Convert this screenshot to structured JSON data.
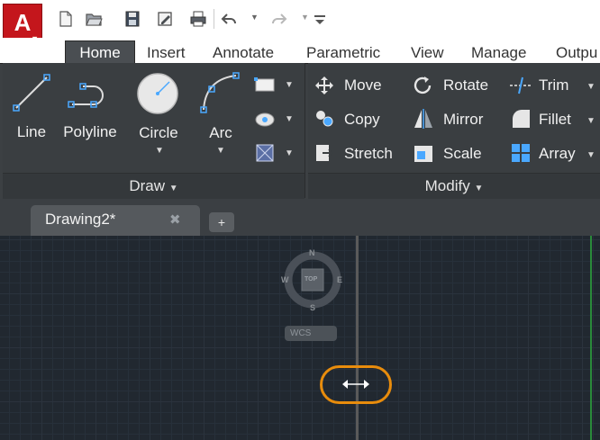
{
  "app": {
    "logo_letter": "A",
    "icons": [
      "new-file-icon",
      "open-folder-icon",
      "save-icon",
      "save-as-icon",
      "print-icon",
      "undo-icon",
      "redo-icon",
      "customize-icon"
    ]
  },
  "tabs": [
    {
      "label": "Home",
      "active": true
    },
    {
      "label": "Insert"
    },
    {
      "label": "Annotate"
    },
    {
      "label": "Parametric"
    },
    {
      "label": "View"
    },
    {
      "label": "Manage"
    },
    {
      "label": "Outpu"
    }
  ],
  "draw_panel": {
    "title": "Draw",
    "tools": [
      {
        "label": "Line"
      },
      {
        "label": "Polyline"
      },
      {
        "label": "Circle"
      },
      {
        "label": "Arc"
      }
    ]
  },
  "modify_panel": {
    "title": "Modify",
    "tools": [
      {
        "label": "Move"
      },
      {
        "label": "Rotate"
      },
      {
        "label": "Trim"
      },
      {
        "label": "Copy"
      },
      {
        "label": "Mirror"
      },
      {
        "label": "Fillet"
      },
      {
        "label": "Stretch"
      },
      {
        "label": "Scale"
      },
      {
        "label": "Array"
      }
    ]
  },
  "file_tab": {
    "label": "Drawing2*",
    "close": "✖",
    "new_tab": "+"
  },
  "viewcube": {
    "north": "N",
    "south": "S",
    "east": "E",
    "west": "W",
    "face": "TOP",
    "wcs": "WCS"
  },
  "colors": {
    "accent_red": "#c4161c",
    "ribbon_bg": "#3a3e41",
    "canvas_bg": "#212830",
    "highlight": "#e88c0c"
  }
}
